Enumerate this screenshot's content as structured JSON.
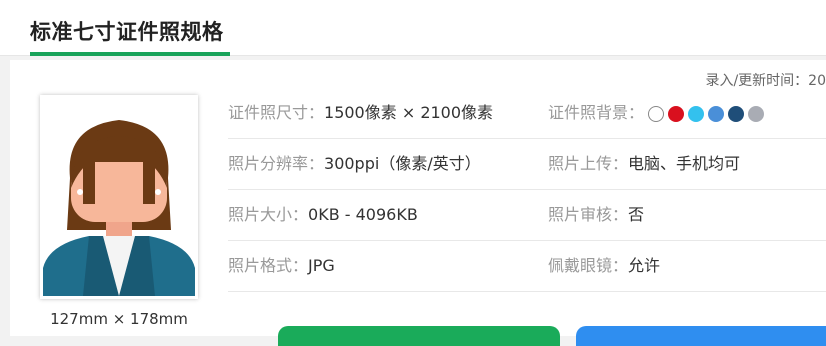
{
  "header": {
    "title": "标准七寸证件照规格"
  },
  "meta": {
    "update_time_label": "录入/更新时间：20"
  },
  "photo": {
    "size_caption": "127mm × 178mm"
  },
  "specs": [
    {
      "left": {
        "label": "证件照尺寸：",
        "value": "1500像素 × 2100像素"
      },
      "right": {
        "label": "证件照背景：",
        "value": ""
      }
    },
    {
      "left": {
        "label": "照片分辨率：",
        "value": "300ppi（像素/英寸）"
      },
      "right": {
        "label": "照片上传：",
        "value": "电脑、手机均可"
      }
    },
    {
      "left": {
        "label": "照片大小：",
        "value": "0KB - 4096KB"
      },
      "right": {
        "label": "照片审核：",
        "value": "否"
      }
    },
    {
      "left": {
        "label": "照片格式：",
        "value": "JPG"
      },
      "right": {
        "label": "佩戴眼镜：",
        "value": "允许"
      }
    }
  ],
  "background_colors": [
    "#ffffff",
    "#d9101e",
    "#33c1ee",
    "#4a8fd8",
    "#1f4e79",
    "#a9acb4"
  ],
  "colors": {
    "accent": "#1aa35a",
    "button_green": "#1aab5a",
    "button_blue": "#2f8ef0"
  }
}
